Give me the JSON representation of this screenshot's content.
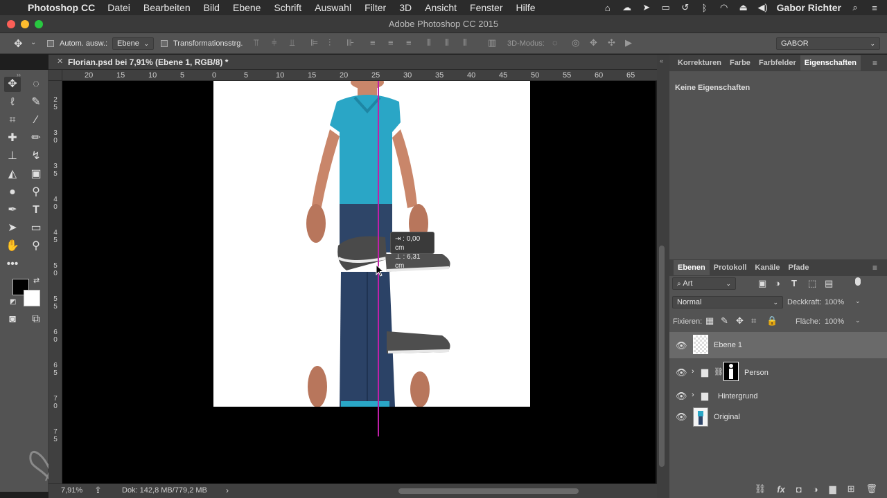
{
  "menubar": {
    "app_name": "Photoshop CC",
    "menus": [
      "Datei",
      "Bearbeiten",
      "Bild",
      "Ebene",
      "Schrift",
      "Auswahl",
      "Filter",
      "3D",
      "Ansicht",
      "Fenster",
      "Hilfe"
    ],
    "user": "Gabor Richter"
  },
  "window": {
    "title": "Adobe Photoshop CC 2015"
  },
  "options": {
    "auto_select_label": "Autom. ausw.:",
    "auto_select_value": "Ebene",
    "transform_label": "Transformationsstrg.",
    "mode_3d_label": "3D-Modus:",
    "workspace": "GABOR"
  },
  "document": {
    "tab_title": "Florian.psd bei 7,91% (Ebene 1, RGB/8) *"
  },
  "rulers": {
    "horizontal": [
      "20",
      "15",
      "10",
      "5",
      "0",
      "5",
      "10",
      "15",
      "20",
      "25",
      "30",
      "35",
      "40",
      "45",
      "50",
      "55",
      "60",
      "65"
    ],
    "vertical": [
      "2\n5",
      "3\n0",
      "3\n5",
      "4\n0",
      "4\n5",
      "5\n0",
      "5\n5",
      "6\n0",
      "6\n5",
      "7\n0",
      "7\n5"
    ]
  },
  "tooltip": {
    "line1": "⇥ : 0,00 cm",
    "line2": "⊥ : 6,31 cm"
  },
  "status": {
    "zoom": "7,91%",
    "doc_size": "Dok: 142,8 MB/779,2 MB"
  },
  "properties_panel": {
    "tabs": [
      "Korrekturen",
      "Farbe",
      "Farbfelder",
      "Eigenschaften"
    ],
    "active_tab": "Eigenschaften",
    "empty_text": "Keine Eigenschaften"
  },
  "layers_panel": {
    "tabs": [
      "Ebenen",
      "Protokoll",
      "Kanäle",
      "Pfade"
    ],
    "active_tab": "Ebenen",
    "filter_kind": "Art",
    "blend_mode": "Normal",
    "opacity_label": "Deckkraft:",
    "opacity_value": "100%",
    "lock_label": "Fixieren:",
    "fill_label": "Fläche:",
    "fill_value": "100%",
    "layers": [
      {
        "name": "Ebene 1",
        "selected": true
      },
      {
        "name": "Person",
        "selected": false
      },
      {
        "name": "Hintergrund",
        "selected": false
      },
      {
        "name": "Original",
        "selected": false
      }
    ]
  },
  "colors": {
    "guide": "#c020a8",
    "shirt": "#2aa6c6",
    "jeans": "#2e4568",
    "skin": "#c9866a"
  }
}
